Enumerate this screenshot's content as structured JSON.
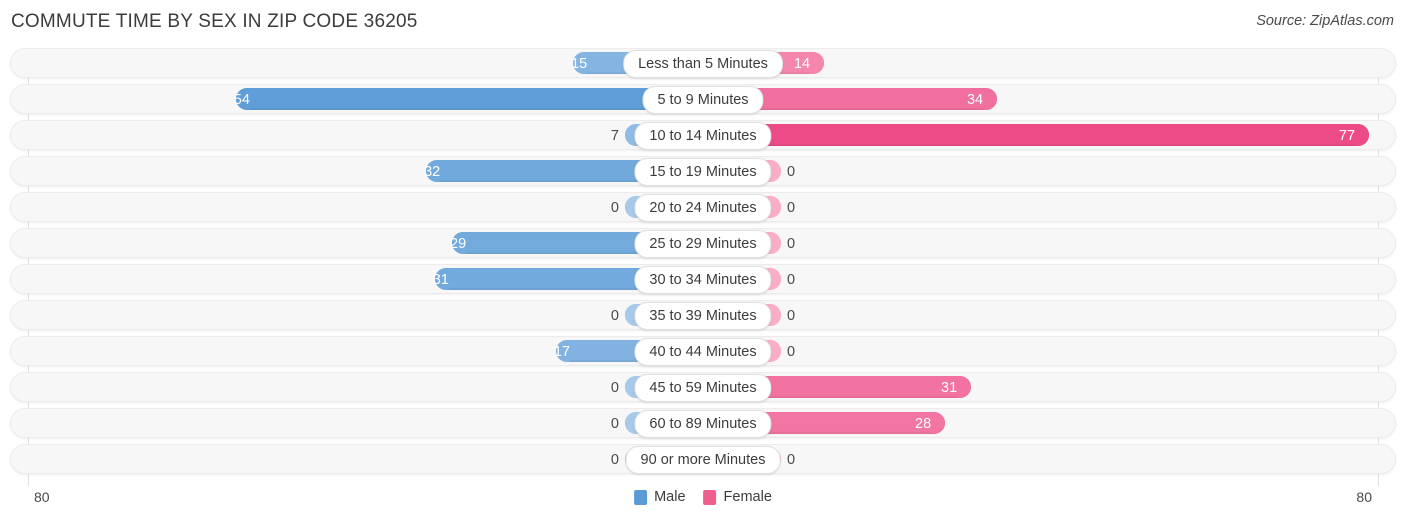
{
  "header": {
    "title": "COMMUTE TIME BY SEX IN ZIP CODE 36205",
    "source": "Source: ZipAtlas.com"
  },
  "footer": {
    "axis_max_left": "80",
    "axis_max_right": "80",
    "legend": [
      {
        "label": "Male",
        "color": "#5b9bd5",
        "swatch_name": "male-swatch"
      },
      {
        "label": "Female",
        "color": "#ee5f8d",
        "swatch_name": "female-swatch"
      }
    ]
  },
  "chart_data": {
    "type": "bar",
    "subtype": "diverging-horizontal-bar",
    "title": "COMMUTE TIME BY SEX IN ZIP CODE 36205",
    "xlabel": "",
    "ylabel": "",
    "axis_max": 80,
    "xlim": [
      80,
      80
    ],
    "grid": false,
    "legend_position": "bottom-center",
    "categories": [
      "Less than 5 Minutes",
      "5 to 9 Minutes",
      "10 to 14 Minutes",
      "15 to 19 Minutes",
      "20 to 24 Minutes",
      "25 to 29 Minutes",
      "30 to 34 Minutes",
      "35 to 39 Minutes",
      "40 to 44 Minutes",
      "45 to 59 Minutes",
      "60 to 89 Minutes",
      "90 or more Minutes"
    ],
    "series": [
      {
        "name": "Male",
        "side": "left",
        "color": "#5b9bd5",
        "values": [
          15,
          54,
          7,
          32,
          0,
          29,
          31,
          0,
          17,
          0,
          0,
          0
        ]
      },
      {
        "name": "Female",
        "side": "right",
        "color": "#ee5f8d",
        "values": [
          14,
          34,
          77,
          0,
          0,
          0,
          0,
          0,
          0,
          31,
          28,
          0
        ]
      }
    ],
    "rows": [
      {
        "category": "Less than 5 Minutes",
        "male": 15,
        "female": 14
      },
      {
        "category": "5 to 9 Minutes",
        "male": 54,
        "female": 34
      },
      {
        "category": "10 to 14 Minutes",
        "male": 7,
        "female": 77
      },
      {
        "category": "15 to 19 Minutes",
        "male": 32,
        "female": 0
      },
      {
        "category": "20 to 24 Minutes",
        "male": 0,
        "female": 0
      },
      {
        "category": "25 to 29 Minutes",
        "male": 29,
        "female": 0
      },
      {
        "category": "30 to 34 Minutes",
        "male": 31,
        "female": 0
      },
      {
        "category": "35 to 39 Minutes",
        "male": 0,
        "female": 0
      },
      {
        "category": "40 to 44 Minutes",
        "male": 17,
        "female": 0
      },
      {
        "category": "45 to 59 Minutes",
        "male": 0,
        "female": 31
      },
      {
        "category": "60 to 89 Minutes",
        "male": 0,
        "female": 28
      },
      {
        "category": "90 or more Minutes",
        "male": 0,
        "female": 0
      }
    ]
  }
}
